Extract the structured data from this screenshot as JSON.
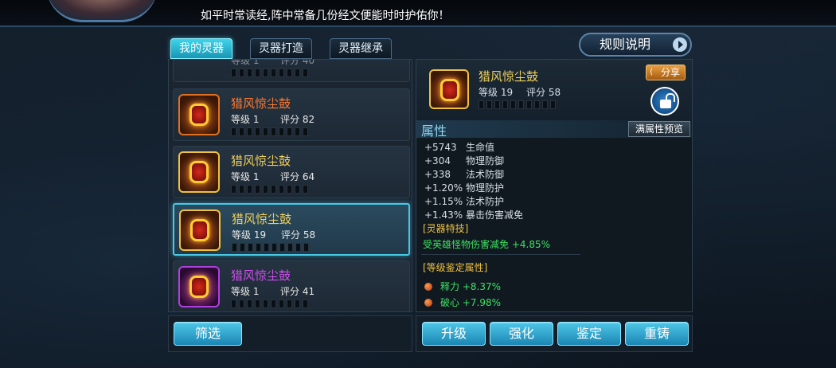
{
  "header": {
    "tip_text": "如平时常读经,阵中常备几份经文便能时时护佑你！"
  },
  "tabs": [
    {
      "label": "我的灵器",
      "active": true
    },
    {
      "label": "灵器打造",
      "active": false
    },
    {
      "label": "灵器继承",
      "active": false
    }
  ],
  "rules_button": {
    "label": "规则说明"
  },
  "item_list": {
    "partial_top": {
      "level_label": "等级 1",
      "score_label": "评分 40"
    },
    "items": [
      {
        "name": "猎风惊尘鼓",
        "name_color": "#ff7a30",
        "level": "等级 1",
        "score": "评分 82",
        "frame": "orange",
        "selected": false
      },
      {
        "name": "猎风惊尘鼓",
        "name_color": "#f2d15c",
        "level": "等级 1",
        "score": "评分 64",
        "frame": "gold",
        "selected": false
      },
      {
        "name": "猎风惊尘鼓",
        "name_color": "#f2d15c",
        "level": "等级 19",
        "score": "评分 58",
        "frame": "gold",
        "selected": true
      },
      {
        "name": "猎风惊尘鼓",
        "name_color": "#d050f0",
        "level": "等级 1",
        "score": "评分 41",
        "frame": "purple",
        "selected": false
      }
    ]
  },
  "detail": {
    "name": "猎风惊尘鼓",
    "level": "等级 19",
    "score": "评分 58",
    "share_label": "分享",
    "attr_title": "属性",
    "preview_label": "满属性预览",
    "attributes": [
      {
        "value": "+5743",
        "name": "生命值"
      },
      {
        "value": "+304",
        "name": "物理防御"
      },
      {
        "value": "+338",
        "name": "法术防御"
      },
      {
        "value": "+1.20%",
        "name": "物理防护"
      },
      {
        "value": "+1.15%",
        "name": "法术防护"
      },
      {
        "value": "+1.43%",
        "name": "暴击伤害减免"
      }
    ],
    "special_title": "[灵器特技]",
    "special_text": "受英雄怪物伤害减免 +4.85%",
    "level_attr_title": "[等级鉴定属性]",
    "level_attrs": [
      {
        "text": "释力 +8.37%"
      },
      {
        "text": "破心 +7.98%"
      }
    ]
  },
  "buttons": {
    "filter": "筛选",
    "upgrade": "升级",
    "strengthen": "强化",
    "identify": "鉴定",
    "recast": "重铸"
  }
}
